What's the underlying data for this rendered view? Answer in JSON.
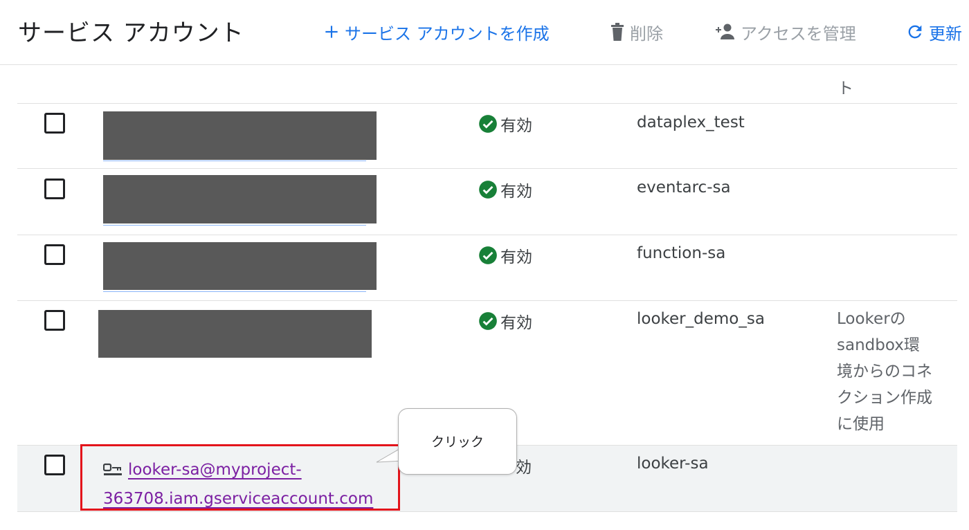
{
  "header": {
    "title": "サービス アカウント",
    "create_label": "サービス アカウントを作成",
    "delete_label": "削除",
    "access_label": "アクセスを管理",
    "refresh_label": "更新"
  },
  "table": {
    "column_fragment": "ト",
    "rows": [
      {
        "status": "有効",
        "name": "dataplex_test",
        "description": ""
      },
      {
        "status": "有効",
        "name": "eventarc-sa",
        "description": ""
      },
      {
        "status": "有効",
        "name": "function-sa",
        "description": ""
      },
      {
        "status": "有効",
        "name": "looker_demo_sa",
        "description": "Lookerのsandbox環境からのコネクション作成に使用"
      },
      {
        "email": "looker-sa@myproject-363708.iam.gserviceaccount.com",
        "status": "効",
        "name": "looker-sa",
        "description": ""
      }
    ]
  },
  "annotation": {
    "callout_text": "クリック",
    "highlight_color": "#e3141b"
  },
  "colors": {
    "accent": "#1a73e8",
    "status_ok": "#188038",
    "link_visited": "#7b1fa2",
    "redaction": "#595959"
  },
  "icons": [
    "plus-icon",
    "trash-icon",
    "add-person-icon",
    "refresh-icon",
    "check-circle-icon",
    "service-account-key-icon"
  ]
}
